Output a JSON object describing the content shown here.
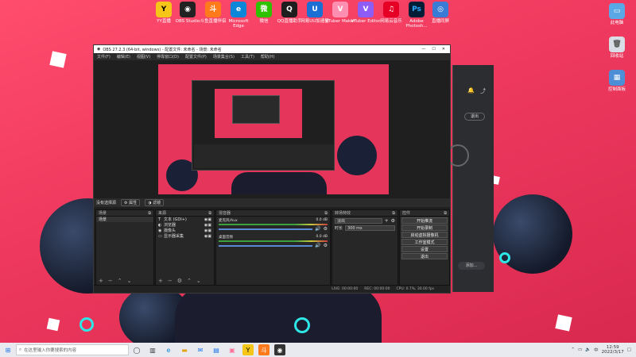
{
  "desktop": {
    "icons": [
      {
        "label": "YY直播",
        "color": "#f5c518",
        "glyph": "Y"
      },
      {
        "label": "OBS Studio",
        "color": "#222",
        "glyph": "◉"
      },
      {
        "label": "斗鱼直播伴侣",
        "color": "#ff7a1a",
        "glyph": "斗"
      },
      {
        "label": "Microsoft Edge",
        "color": "#0b86d9",
        "glyph": "e"
      },
      {
        "label": "微信",
        "color": "#2dc100",
        "glyph": "微"
      },
      {
        "label": "QQ直播助手",
        "color": "#1e1e1e",
        "glyph": "Q"
      },
      {
        "label": "网易UU加速器",
        "color": "#1a6fd4",
        "glyph": "U"
      },
      {
        "label": "VTuber Maker",
        "color": "#ff8fb0",
        "glyph": "V"
      },
      {
        "label": "VTuber Editor",
        "color": "#8e5cf7",
        "glyph": "V"
      },
      {
        "label": "网易云音乐",
        "color": "#e60026",
        "glyph": "♫"
      },
      {
        "label": "Adobe Photosh...",
        "color": "#001e36",
        "glyph": "Ps"
      },
      {
        "label": "直播同屏",
        "color": "#3a7bd5",
        "glyph": "◎"
      }
    ],
    "right_icons": [
      {
        "label": "此电脑",
        "glyph": "▭"
      },
      {
        "label": "回收站",
        "glyph": "🗑"
      },
      {
        "label": "控制面板",
        "glyph": "▦"
      }
    ]
  },
  "obs": {
    "title": "OBS 27.2.3 (64-bit, windows) - 配置文件: 未命名 - 场景: 未命名",
    "menu": [
      "文件(F)",
      "编辑(E)",
      "视图(V)",
      "停靠窗口(D)",
      "配置文件(P)",
      "场景集合(S)",
      "工具(T)",
      "帮助(H)"
    ],
    "toolbar_label": "没有选择源",
    "toolbar_buttons": [
      "属性",
      "滤镜"
    ],
    "scenes_title": "场景",
    "scenes": [
      "场景"
    ],
    "sources_title": "来源",
    "sources": [
      {
        "icon": "T",
        "label": "文本 (GDI+)"
      },
      {
        "icon": "◐",
        "label": "浏览器"
      },
      {
        "icon": "◉",
        "label": "摄像头"
      },
      {
        "icon": "▭",
        "label": "显示器采集"
      }
    ],
    "mixer_title": "混音器",
    "mixer": [
      {
        "name": "桌面音频",
        "db": "0.0 dB"
      },
      {
        "name": "麦克风/Aux",
        "db": "0.0 dB"
      }
    ],
    "transitions_title": "转场特效",
    "transition_type": "淡出",
    "duration_label": "时长",
    "duration_value": "300 ms",
    "controls_title": "控件",
    "controls": [
      "开始推流",
      "开始录制",
      "启动虚拟摄像机",
      "工作室模式",
      "设置",
      "退出"
    ],
    "status": {
      "live": "LIVE: 00:00:00",
      "rec": "REC: 00:00:00",
      "cpu": "CPU: 0.7%, 30.00 fps"
    }
  },
  "side_panel": {
    "button": "退出",
    "bottom_button": "添加..."
  },
  "taskbar": {
    "search_placeholder": "在这里输入你要搜索的内容",
    "time": "12:59",
    "date": "2022/3/17",
    "lang": "中"
  }
}
